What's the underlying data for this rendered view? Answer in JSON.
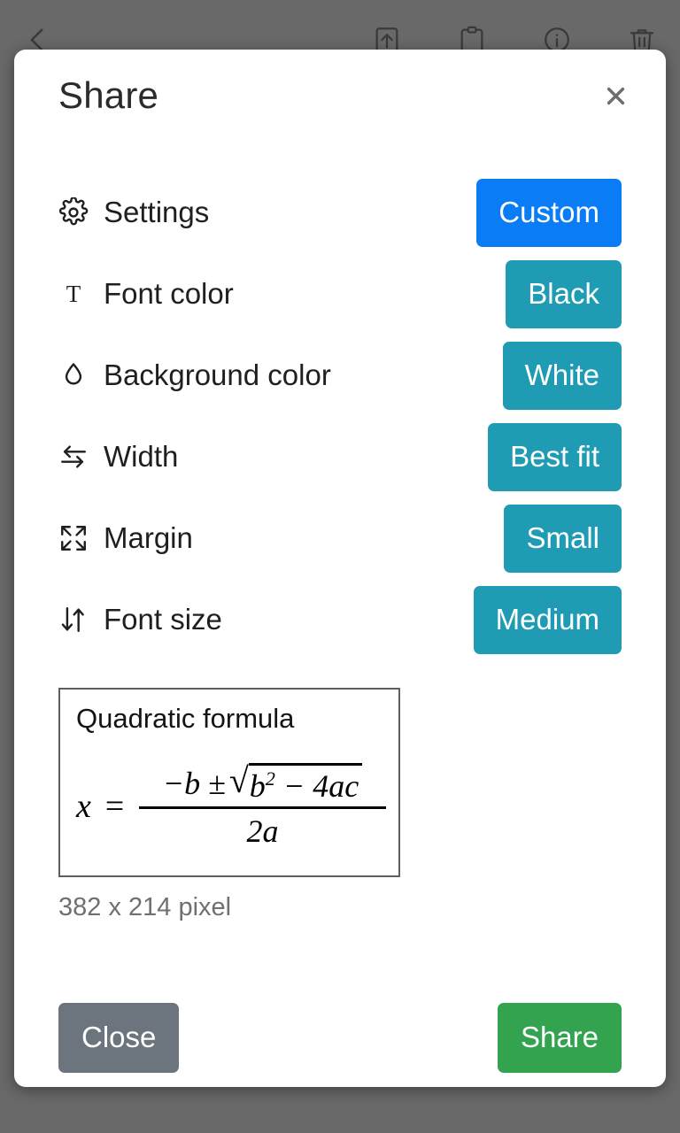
{
  "background_app": {
    "toolbar": {
      "back_icon": "back-arrow-icon",
      "actions": [
        {
          "icon": "export-icon",
          "name": "export-button"
        },
        {
          "icon": "clipboard-icon",
          "name": "clipboard-button"
        },
        {
          "icon": "info-icon",
          "name": "info-button"
        },
        {
          "icon": "trash-icon",
          "name": "delete-button"
        }
      ]
    }
  },
  "dialog": {
    "title": "Share",
    "close_icon": "close-icon",
    "settings": [
      {
        "icon": "gear-icon",
        "label": "Settings",
        "value": "Custom",
        "accent": true
      },
      {
        "icon": "text-color-icon",
        "label": "Font color",
        "value": "Black",
        "accent": false
      },
      {
        "icon": "droplet-icon",
        "label": "Background color",
        "value": "White",
        "accent": false
      },
      {
        "icon": "width-arrows-icon",
        "label": "Width",
        "value": "Best fit",
        "accent": false
      },
      {
        "icon": "expand-icon",
        "label": "Margin",
        "value": "Small",
        "accent": false
      },
      {
        "icon": "font-size-icon",
        "label": "Font size",
        "value": "Medium",
        "accent": false
      }
    ],
    "preview": {
      "title": "Quadratic formula",
      "formula": {
        "lhs": "x =",
        "numerator_prefix": "−b ±",
        "radicand_base": "b",
        "radicand_exponent": "2",
        "radicand_rest": "− 4ac",
        "denominator": "2a"
      },
      "size_label": "382 x 214 pixel"
    },
    "footer": {
      "close_label": "Close",
      "share_label": "Share"
    }
  },
  "colors": {
    "accent_blue": "#0a7cf5",
    "teal": "#1f9cb4",
    "green": "#33a350",
    "gray": "#6c757d",
    "scrim": "#7a7a7a"
  }
}
